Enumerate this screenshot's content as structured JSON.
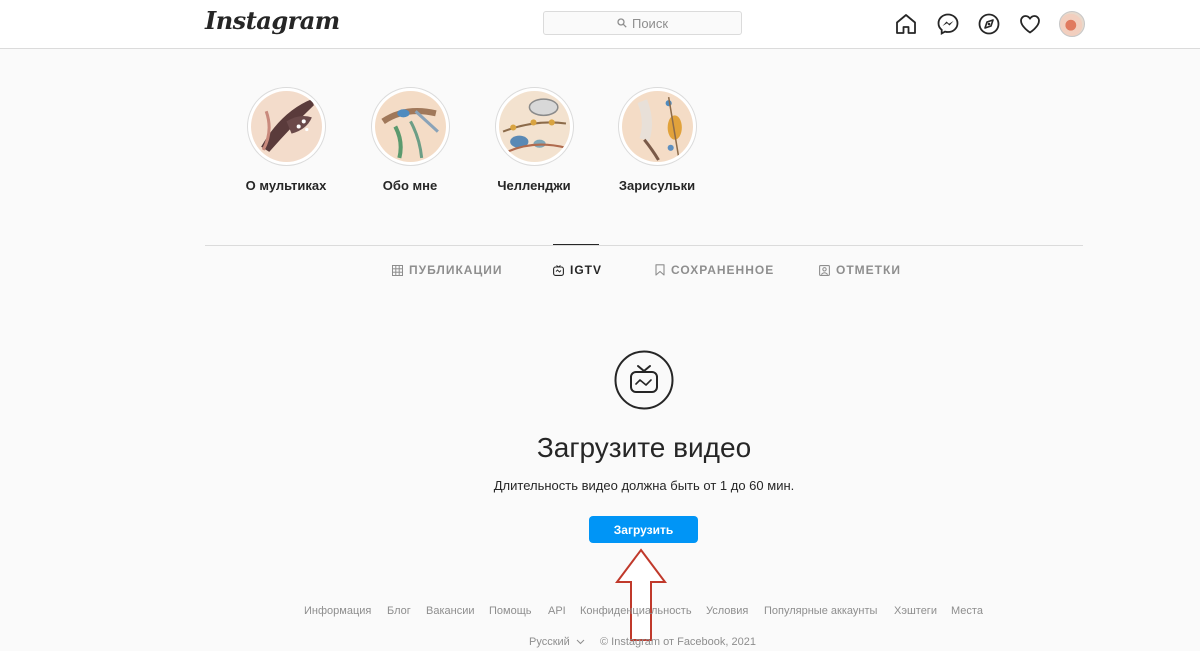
{
  "header": {
    "logo": "Instagram",
    "search_placeholder": "Поиск",
    "icons": [
      "home-icon",
      "messenger-icon",
      "explore-icon",
      "heart-icon",
      "profile-avatar"
    ]
  },
  "highlights": [
    {
      "label": "О мультиках"
    },
    {
      "label": "Обо мне"
    },
    {
      "label": "Челленджи"
    },
    {
      "label": "Зарисульки"
    }
  ],
  "tabs": [
    {
      "label": "ПУБЛИКАЦИИ",
      "icon": "grid-icon",
      "active": false
    },
    {
      "label": "IGTV",
      "icon": "igtv-icon",
      "active": true
    },
    {
      "label": "СОХРАНЕННОЕ",
      "icon": "bookmark-icon",
      "active": false
    },
    {
      "label": "ОТМЕТКИ",
      "icon": "tagged-icon",
      "active": false
    }
  ],
  "empty_state": {
    "title": "Загрузите видео",
    "subtitle": "Длительность видео должна быть от 1 до 60 мин.",
    "button": "Загрузить"
  },
  "footer": {
    "links": [
      "Информация",
      "Блог",
      "Вакансии",
      "Помощь",
      "API",
      "Конфиденциальность",
      "Условия",
      "Популярные аккаунты",
      "Хэштеги",
      "Места"
    ],
    "language": "Русский",
    "copyright": "© Instagram от Facebook, 2021"
  },
  "colors": {
    "accent": "#0095f6",
    "background": "#fafafa",
    "arrow": "#c0392b"
  }
}
